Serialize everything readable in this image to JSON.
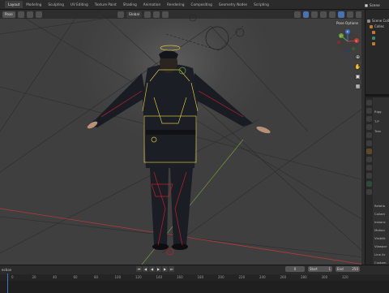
{
  "workspace_tabs": [
    "Layout",
    "Modeling",
    "Sculpting",
    "UV Editing",
    "Texture Paint",
    "Shading",
    "Animation",
    "Rendering",
    "Compositing",
    "Geometry Nodes",
    "Scripting"
  ],
  "active_tab": "Layout",
  "scene": {
    "label": "Scene"
  },
  "viewport_header": {
    "mode": "Pose",
    "transform_orientation": "Global"
  },
  "pose_options_label": "Pose Options",
  "gizmo": {
    "x": "X",
    "y": "Y",
    "z": "Z"
  },
  "nav_icons": [
    "zoom-icon",
    "pan-hand-icon",
    "camera-icon",
    "grid-icon"
  ],
  "outliner": {
    "rows": [
      {
        "label": "Scene Coll"
      },
      {
        "label": "Collec"
      },
      {
        "label": ""
      },
      {
        "label": ""
      },
      {
        "label": ""
      }
    ]
  },
  "properties": {
    "rows": [
      "Rigg",
      "T-P",
      "Tran",
      "Relatio",
      "Collect",
      "Instanc",
      "Motion",
      "Visibilit",
      "Viewpor",
      "Line Ar",
      "Custom"
    ]
  },
  "timeline": {
    "left_label": "ection",
    "current_frame": "0",
    "start_label": "Start",
    "start_value": "1",
    "end_label": "End",
    "end_value": "250",
    "ruler_ticks": [
      "0",
      "20",
      "40",
      "60",
      "80",
      "100",
      "120",
      "140",
      "160",
      "180",
      "200",
      "220",
      "240",
      "260",
      "280",
      "300",
      "320"
    ]
  },
  "colors": {
    "accent": "#4772b3",
    "bone_yellow": "#d9c33f",
    "bone_red": "#c0202a",
    "axis_x": "#c23a3a",
    "axis_y": "#6aa03a"
  }
}
